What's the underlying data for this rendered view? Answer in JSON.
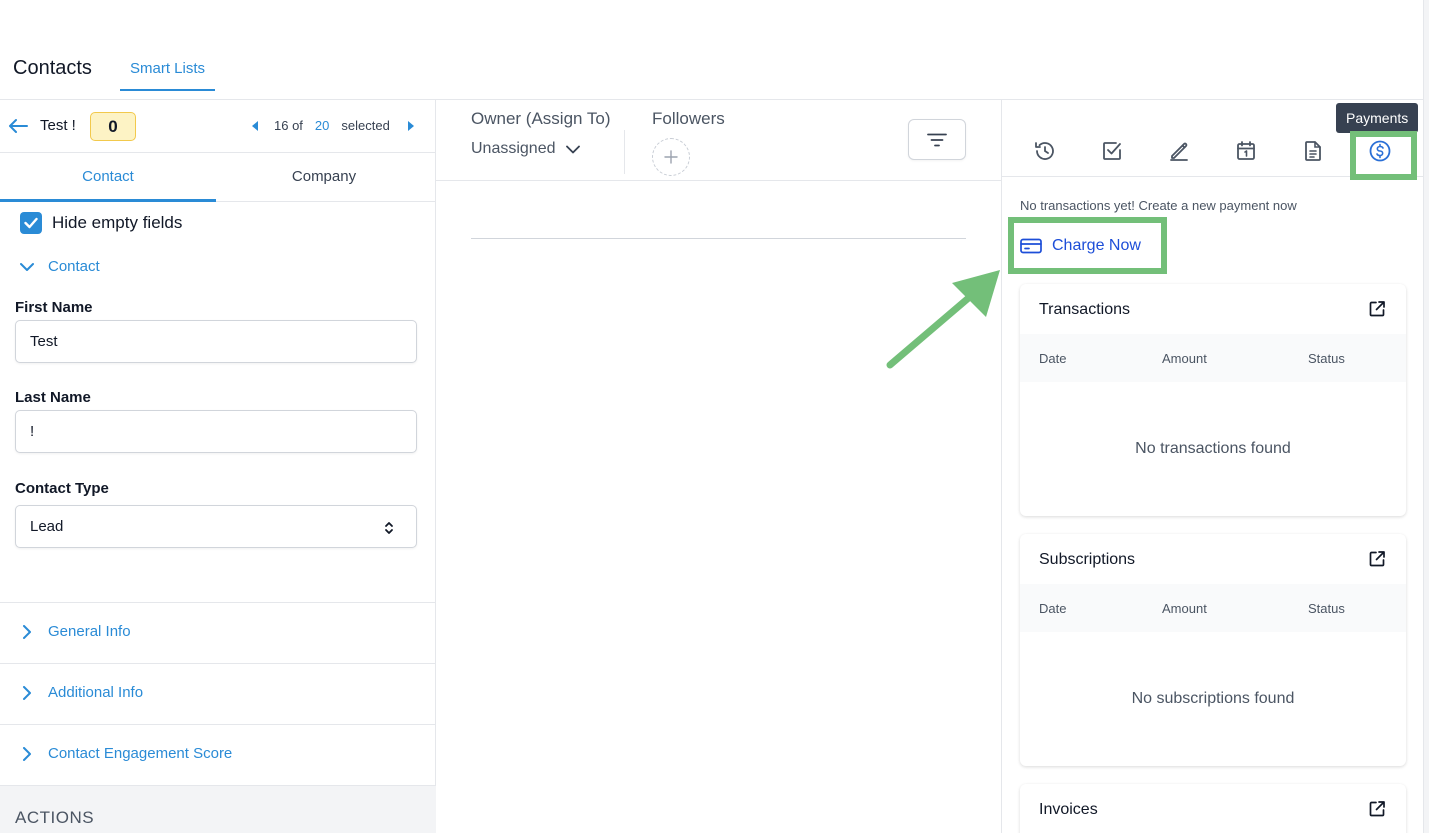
{
  "topbar": {
    "title": "Contacts",
    "tab_smart_lists": "Smart Lists"
  },
  "left": {
    "contact_name": "Test !",
    "count_badge": "0",
    "pager": {
      "current": "16 of",
      "total": "20",
      "suffix": "selected"
    },
    "tabs": {
      "contact": "Contact",
      "company": "Company"
    },
    "hide_empty_label": "Hide empty fields",
    "hide_empty_checked": true,
    "section_contact": "Contact",
    "fields": {
      "first_name_label": "First Name",
      "first_name_value": "Test",
      "last_name_label": "Last Name",
      "last_name_value": "!",
      "contact_type_label": "Contact Type",
      "contact_type_value": "Lead"
    },
    "collapsed_sections": {
      "general_info": "General Info",
      "additional_info": "Additional Info",
      "engagement_score": "Contact Engagement Score"
    },
    "actions_label": "ACTIONS"
  },
  "middle": {
    "owner_label": "Owner (Assign To)",
    "owner_value": "Unassigned",
    "followers_label": "Followers"
  },
  "right": {
    "tooltip": "Payments",
    "icons": [
      "clock-icon",
      "check-square-icon",
      "pen-icon",
      "calendar-icon",
      "document-icon",
      "dollar-circle-icon"
    ],
    "no_transactions_text": "No transactions yet! Create a new payment now",
    "charge_now": "Charge Now",
    "transactions": {
      "title": "Transactions",
      "col_date": "Date",
      "col_amount": "Amount",
      "col_status": "Status",
      "empty": "No transactions found"
    },
    "subscriptions": {
      "title": "Subscriptions",
      "col_date": "Date",
      "col_amount": "Amount",
      "col_status": "Status",
      "empty": "No subscriptions found"
    },
    "invoices": {
      "title": "Invoices"
    }
  },
  "colors": {
    "accent": "#2a8bd6",
    "highlight": "#73bf79",
    "link": "#1d4ed8"
  }
}
